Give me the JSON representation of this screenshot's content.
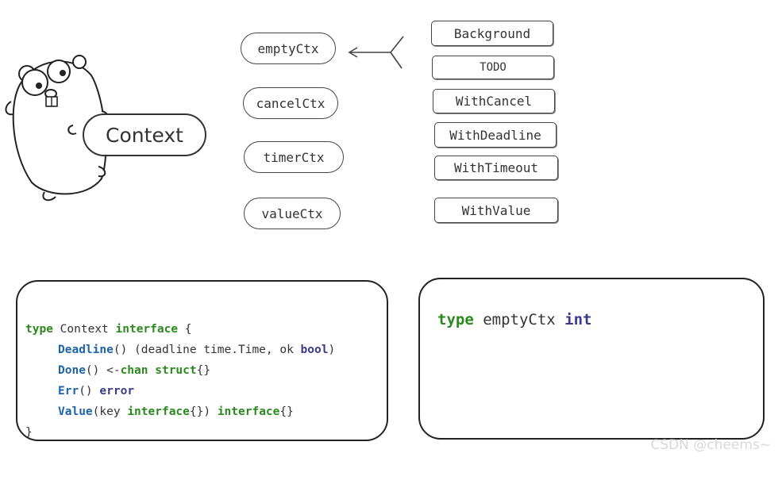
{
  "context_label": "Context",
  "ctx_types": [
    "emptyCtx",
    "cancelCtx",
    "timerCtx",
    "valueCtx"
  ],
  "functions": [
    "Background",
    "TODO",
    "WithCancel",
    "WithDeadline",
    "WithTimeout",
    "WithValue"
  ],
  "interface_code": {
    "line1": {
      "kw": "type",
      "name": " Context ",
      "kw2": "interface",
      "rest": " {"
    },
    "line2": {
      "method": "Deadline",
      "rest1": "() (deadline time.Time, ok ",
      "kw": "bool",
      "rest2": ")"
    },
    "line3": {
      "method": "Done",
      "rest1": "() <-",
      "kw": "chan",
      "sp": " ",
      "kw2": "struct",
      "rest2": "{}"
    },
    "line4": {
      "method": "Err",
      "rest1": "() ",
      "kw": "error"
    },
    "line5": {
      "method": "Value",
      "rest1": "(key ",
      "kw": "interface",
      "rest2": "{}) ",
      "kw2": "interface",
      "rest3": "{}"
    },
    "line6": "}"
  },
  "emptyctx_code": {
    "kw": "type",
    "name": " emptyCtx ",
    "kw2": "int"
  },
  "watermark": "CSDN @cheems~"
}
